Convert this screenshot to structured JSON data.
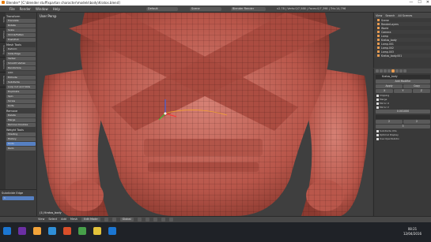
{
  "window": {
    "title": "Blender* [C:\\blender stuff\\spartan character\\models\\body\\Kratos.blend]",
    "buttons": [
      "—",
      "☐",
      "✕"
    ]
  },
  "menubar": {
    "items": [
      "File",
      "Render",
      "Window",
      "Help"
    ],
    "layout": "Default",
    "scene": "Scene",
    "engine": "Blender Render",
    "stats": "v2.78 | Verts:0/7,588 | Faces:0/7,398 | Tris:14,796"
  },
  "toolshelf": {
    "tabs": [
      "Tools",
      "Create",
      "Shading",
      "Options",
      "Grease"
    ],
    "sections": [
      {
        "title": "Transform",
        "buttons": [
          "Translate",
          "Rotate",
          "Scale",
          "Shrink/Fatten",
          "Push/Pull"
        ]
      },
      {
        "title": "Mesh Tools",
        "buttons": [
          "Deform:",
          "Slide Edge",
          "Vertex",
          "Smooth Vertex",
          "Randomize",
          "Add:",
          "Extrude",
          "Subdivide",
          "Loop Cut and Slide",
          "Duplicate",
          "Spin",
          "Screw",
          "Knife"
        ]
      },
      {
        "title": "Remove",
        "buttons": [
          "Delete",
          "Merge",
          "Remove Doubles"
        ]
      },
      {
        "title": "Weight Tools",
        "buttons": [
          "Shading",
          "History",
          "Undo",
          "Redo"
        ]
      }
    ],
    "last_op": {
      "title": "Subdivide Edge",
      "value": "1"
    }
  },
  "viewport": {
    "label": "User Persp",
    "object": "(1) Kratos_body"
  },
  "header3d": {
    "items": [
      "View",
      "Select",
      "Add",
      "Mesh"
    ],
    "mode": "Edit Mode",
    "pivot": "Global"
  },
  "outliner": {
    "tabs": [
      "View",
      "Search",
      "All Scenes"
    ],
    "rows": [
      "Scene",
      "RenderLayers",
      "World",
      "Camera",
      "Lamp",
      "Kratos_body",
      "Lamp.001",
      "Lamp.002",
      "Lamp.003",
      "Kratos_body.001"
    ]
  },
  "properties": {
    "object_name": "Kratos_body",
    "sections": [
      "Add Modifier",
      "Apply",
      "Copy"
    ],
    "toggles": [
      "X",
      "Y",
      "Z"
    ],
    "checks": [
      "Clipping",
      "Merge",
      "Mirror U",
      "Mirror V"
    ],
    "merge_limit": "0.001000",
    "mirror_object": "",
    "subsurf": {
      "view": "2",
      "render": "2",
      "quality": "3"
    },
    "options": [
      "Subdivide UVs",
      "Optimal Display",
      "Use OpenSubdiv"
    ]
  },
  "taskbar": {
    "time": "08:21",
    "date": "12/04/2016",
    "icon_colors": [
      "#1b76d2",
      "#6b2fa4",
      "#f2a33a",
      "#2f8fd8",
      "#d94f2a",
      "#47a04a",
      "#e4c33b",
      "#1b76d2"
    ]
  }
}
